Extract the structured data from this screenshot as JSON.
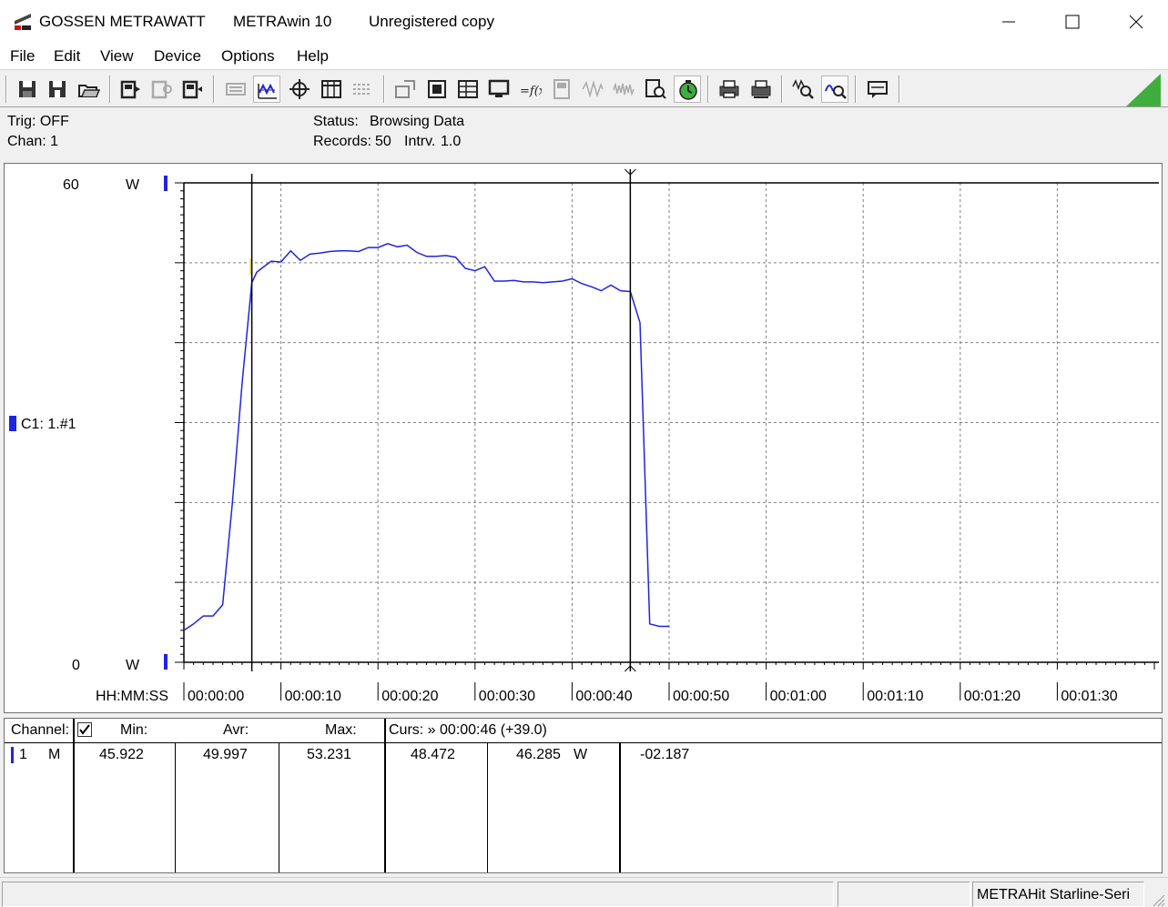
{
  "titlebar": {
    "brand": "GOSSEN METRAWATT",
    "app": "METRAwin 10",
    "license": "Unregistered copy"
  },
  "menu": [
    "File",
    "Edit",
    "View",
    "Device",
    "Options",
    "Help"
  ],
  "toolbar": {
    "icons": [
      "save-disk-icon",
      "save-as-disk-icon",
      "open-folder-icon",
      "device-read-icon",
      "device-config-icon",
      "device-send-icon",
      "keyboard-icon",
      "trace-view-icon",
      "cursor-crosshair-icon",
      "table-view-icon",
      "list-view-icon",
      "export-icon",
      "print-preview-icon",
      "spreadsheet-icon",
      "monitor-icon",
      "function-icon",
      "meter-icon",
      "waveform-icon",
      "noise-icon",
      "search-doc-icon",
      "timer-icon",
      "printer-icon",
      "printer-setup-icon",
      "zoom-peak-icon",
      "zoom-curve-icon",
      "comment-icon"
    ]
  },
  "info": {
    "trig": "Trig: OFF",
    "chan": "Chan:  1",
    "status_label": "Status:",
    "status_value": "Browsing Data",
    "records_label": "Records:",
    "records_value": "50",
    "interval_label": "Intrv.",
    "interval_value": "1.0"
  },
  "chart_data": {
    "type": "line",
    "y_top_label": "60",
    "y_bottom_label": "0",
    "y_unit_top": "W",
    "y_unit_bottom": "W",
    "channel_label": "C1: 1.#1",
    "x_axis_label": "HH:MM:SS",
    "xticks": [
      "00:00:00",
      "00:00:10",
      "00:00:20",
      "00:00:30",
      "00:00:40",
      "00:00:50",
      "00:01:00",
      "00:01:10",
      "00:01:20",
      "00:01:30"
    ],
    "xlim": [
      0,
      100
    ],
    "ylim": [
      0,
      60
    ],
    "grid": true,
    "line_color": "#1f24e0",
    "cursor_1_time": 7,
    "cursor_2_time": 46,
    "series": [
      {
        "x": [
          0,
          1,
          2,
          3,
          4,
          5,
          6,
          7,
          7.5,
          8,
          9,
          10,
          11,
          12,
          13,
          14,
          15,
          16,
          17,
          18,
          19,
          20,
          21,
          22,
          23,
          24,
          25,
          26,
          27,
          28,
          29,
          30,
          31,
          32,
          33,
          34,
          35,
          36,
          37,
          38,
          39,
          40,
          41,
          42,
          43,
          44,
          45,
          46,
          47,
          48,
          49,
          50
        ],
        "y": [
          4.0,
          4.8,
          5.8,
          5.8,
          7.2,
          20.0,
          35.0,
          47.5,
          48.8,
          49.3,
          50.2,
          50.1,
          51.5,
          50.3,
          51.1,
          51.2,
          51.4,
          51.5,
          51.5,
          51.4,
          51.9,
          51.9,
          52.4,
          52.0,
          52.2,
          51.3,
          50.8,
          50.8,
          50.9,
          50.7,
          49.3,
          49.0,
          49.5,
          47.7,
          47.7,
          47.8,
          47.6,
          47.6,
          47.5,
          47.6,
          47.7,
          48.0,
          47.4,
          47.0,
          46.5,
          47.2,
          46.5,
          46.4,
          42.5,
          4.8,
          4.5,
          4.5
        ]
      }
    ]
  },
  "table": {
    "headers": {
      "channel": "Channel:",
      "min": "Min:",
      "avr": "Avr:",
      "max": "Max:",
      "curs": "Curs: » 00:00:46 (+39.0)"
    },
    "row": {
      "num": "1",
      "mode": "M",
      "min": "45.922",
      "avr": "49.997",
      "max": "53.231",
      "cursor1": "48.472",
      "cursor2": "46.285",
      "unit": "W",
      "delta": "-02.187"
    }
  },
  "statusbar": {
    "device": "METRAHit Starline-Seri"
  }
}
